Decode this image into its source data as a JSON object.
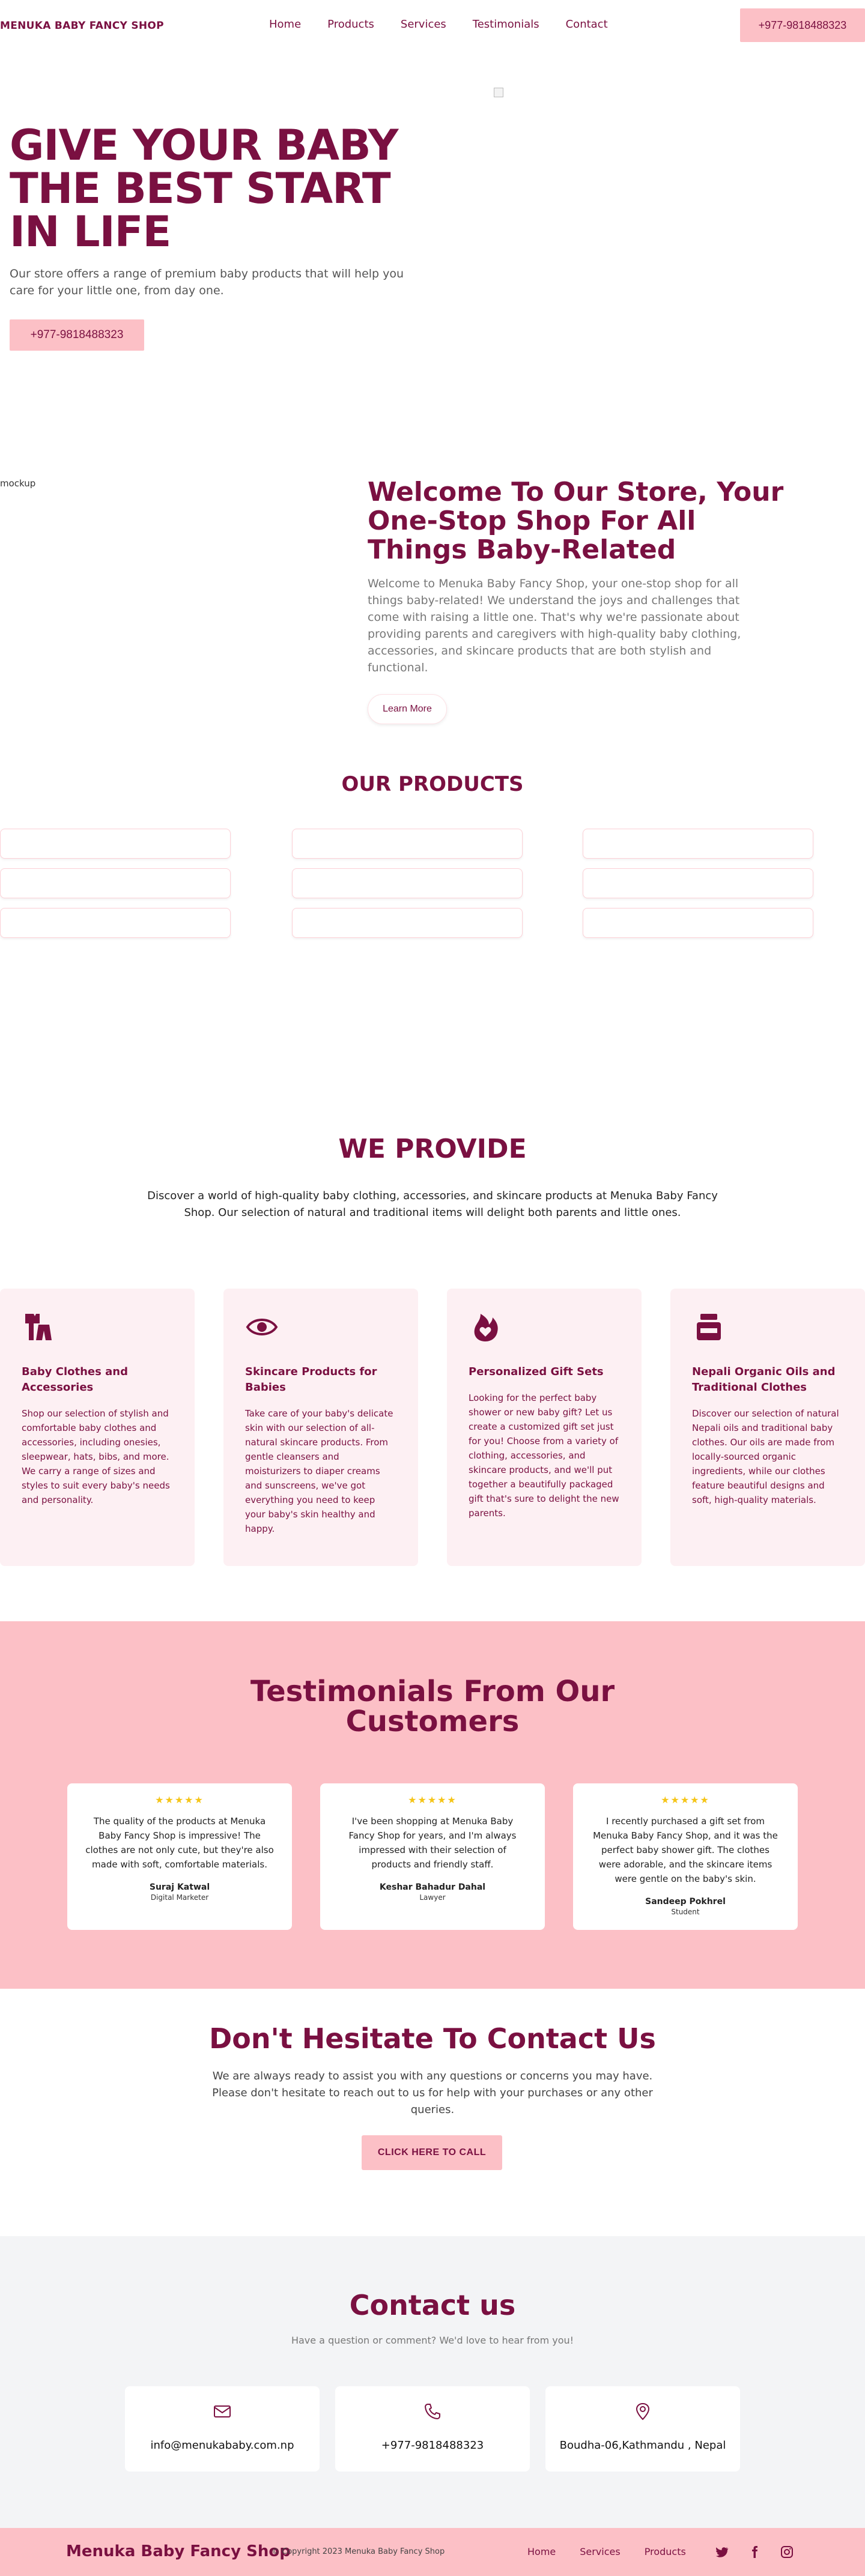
{
  "nav": {
    "brand": "MENUKA BABY FANCY SHOP",
    "links": [
      "Home",
      "Products",
      "Services",
      "Testimonials",
      "Contact"
    ],
    "phone": "+977-9818488323"
  },
  "hero": {
    "title": "GIVE YOUR BABY THE BEST START IN LIFE",
    "text": "Our store offers a range of premium baby products that will help you care for your little one, from day one.",
    "cta": "+977-9818488323"
  },
  "welcome": {
    "image_alt": "mockup",
    "title": "Welcome To Our Store, Your One-Stop Shop For All Things Baby-Related",
    "text": "Welcome to Menuka Baby Fancy Shop, your one-stop shop for all things baby-related! We understand the joys and challenges that come with raising a little one. That's why we're passionate about providing parents and caregivers with high-quality baby clothing, accessories, and skincare products that are both stylish and functional.",
    "cta": "Learn More"
  },
  "products": {
    "title": "OUR PRODUCTS"
  },
  "provide": {
    "title": "WE PROVIDE",
    "intro": "Discover a world of high-quality baby clothing, accessories, and skincare products at Menuka Baby Fancy Shop. Our selection of natural and traditional items will delight both parents and little ones.",
    "items": [
      {
        "icon": "clothes-icon",
        "title": "Baby Clothes and Accessories",
        "text": "Shop our selection of stylish and comfortable baby clothes and accessories, including onesies, sleepwear, hats, bibs, and more. We carry a range of sizes and styles to suit every baby's needs and personality."
      },
      {
        "icon": "eye-icon",
        "title": "Skincare Products for Babies",
        "text": "Take care of your baby's delicate skin with our selection of all-natural skincare products. From gentle cleansers and moisturizers to diaper creams and sunscreens, we've got everything you need to keep your baby's skin healthy and happy."
      },
      {
        "icon": "fire-heart-icon",
        "title": "Personalized Gift Sets",
        "text": "Looking for the perfect baby shower or new baby gift? Let us create a customized gift set just for you! Choose from a variety of clothing, accessories, and skincare products, and we'll put together a beautifully packaged gift that's sure to delight the new parents."
      },
      {
        "icon": "jar-icon",
        "title": "Nepali Organic Oils and Traditional Clothes",
        "text": "Discover our selection of natural Nepali oils and traditional baby clothes. Our oils are made from locally-sourced organic ingredients, while our clothes feature beautiful designs and soft, high-quality materials."
      }
    ]
  },
  "testimonials": {
    "title": "Testimonials From Our Customers",
    "stars": "★★★★★",
    "items": [
      {
        "quote": "The quality of the products at Menuka Baby Fancy Shop is impressive! The clothes are not only cute, but they're also made with soft, comfortable materials.",
        "name": "Suraj Katwal",
        "role": "Digital Marketer"
      },
      {
        "quote": "I've been shopping at Menuka Baby Fancy Shop for years, and I'm always impressed with their selection of products and friendly staff.",
        "name": "Keshar Bahadur Dahal",
        "role": "Lawyer"
      },
      {
        "quote": "I recently purchased a gift set from Menuka Baby Fancy Shop, and it was the perfect baby shower gift. The clothes were adorable, and the skincare items were gentle on the baby's skin.",
        "name": "Sandeep Pokhrel",
        "role": "Student"
      }
    ]
  },
  "contact_cta": {
    "title": "Don't Hesitate To Contact Us",
    "text": "We are always ready to assist you with any questions or concerns you may have. Please don't hesitate to reach out to us for help with your purchases or any other queries.",
    "button": "CLICK HERE TO CALL"
  },
  "contact_us": {
    "title": "Contact us",
    "subtitle": "Have a question or comment? We'd love to hear from you!",
    "items": [
      {
        "icon": "mail-icon",
        "value": "info@menukababy.com.np"
      },
      {
        "icon": "phone-icon",
        "value": "+977-9818488323"
      },
      {
        "icon": "location-pin-icon",
        "value": "Boudha-06,Kathmandu , Nepal"
      }
    ]
  },
  "footer": {
    "brand": "Menuka Baby Fancy Shop",
    "copyright": "© Copyright 2023 Menuka Baby Fancy Shop",
    "links": [
      "Home",
      "Services",
      "Products"
    ],
    "social": [
      "twitter-icon",
      "facebook-icon",
      "instagram-icon"
    ]
  },
  "colors": {
    "maroon": "#7a1041",
    "pink": "#fcc0c6",
    "pink_light": "#fdf0f3",
    "gray": "#f3f4f6",
    "star": "#f5c518"
  }
}
